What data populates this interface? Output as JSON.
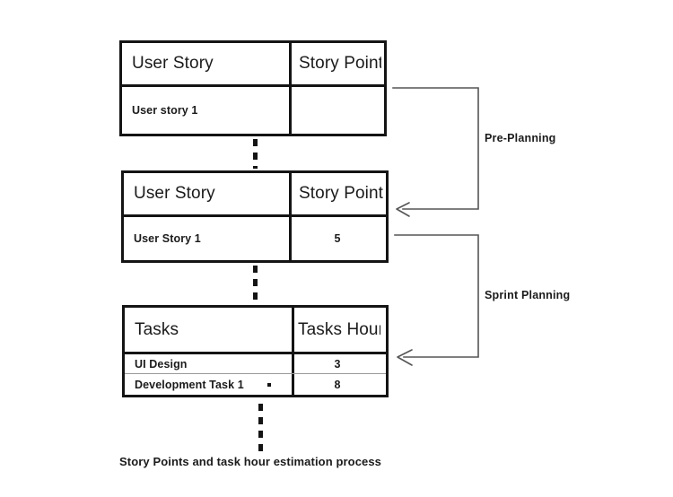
{
  "diagram": {
    "caption": "Story Points and task hour estimation process",
    "tables": [
      {
        "id": "user-story-empty",
        "header": {
          "left": "User Story",
          "right": "Story Point"
        },
        "rows": [
          {
            "left": "User story 1",
            "right": ""
          }
        ]
      },
      {
        "id": "user-story-estimated",
        "header": {
          "left": "User Story",
          "right": "Story Point"
        },
        "rows": [
          {
            "left": "User Story 1",
            "right": "5"
          }
        ]
      },
      {
        "id": "tasks-estimated",
        "header": {
          "left": "Tasks",
          "right": "Tasks Hours"
        },
        "rows": [
          {
            "left": "UI Design",
            "right": "3"
          },
          {
            "left": "Development Task 1",
            "right": "8"
          }
        ]
      }
    ],
    "phases": [
      {
        "id": "pre-planning",
        "label": "Pre-Planning"
      },
      {
        "id": "sprint-planning",
        "label": "Sprint Planning"
      }
    ],
    "colors": {
      "border": "#141414",
      "text": "#1b1b1b",
      "line": "#555555",
      "background": "#ffffff",
      "row_divider": "#9a9a9a"
    }
  }
}
